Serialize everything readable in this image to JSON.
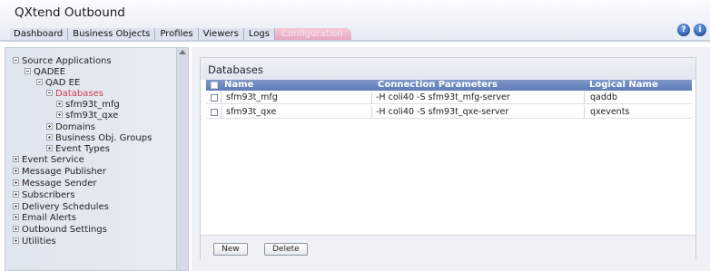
{
  "app": {
    "title": "QXtend Outbound"
  },
  "tabs": [
    {
      "label": "Dashboard"
    },
    {
      "label": "Business Objects"
    },
    {
      "label": "Profiles"
    },
    {
      "label": "Viewers"
    },
    {
      "label": "Logs"
    },
    {
      "label": "Configuration",
      "active": true
    }
  ],
  "header_icons": {
    "help": "?",
    "info": "i"
  },
  "tree": [
    {
      "label": "Source Applications",
      "expanded": true
    },
    {
      "label": "QADEE",
      "expanded": true
    },
    {
      "label": "QAD EE",
      "expanded": true
    },
    {
      "label": "Databases",
      "expanded": true,
      "selected": true
    },
    {
      "label": "sfm93t_mfg",
      "expanded": false
    },
    {
      "label": "sfm93t_qxe",
      "expanded": false
    },
    {
      "label": "Domains",
      "expanded": false
    },
    {
      "label": "Business Obj. Groups",
      "expanded": false
    },
    {
      "label": "Event Types",
      "expanded": false
    },
    {
      "label": "Event Service",
      "expanded": false
    },
    {
      "label": "Message Publisher",
      "expanded": false
    },
    {
      "label": "Message Sender",
      "expanded": false
    },
    {
      "label": "Subscribers",
      "expanded": false
    },
    {
      "label": "Delivery Schedules",
      "expanded": false
    },
    {
      "label": "Email Alerts",
      "expanded": false
    },
    {
      "label": "Outbound Settings",
      "expanded": false
    },
    {
      "label": "Utilities",
      "expanded": false
    }
  ],
  "databases": {
    "title": "Databases",
    "columns": {
      "name": "Name",
      "params": "Connection Parameters",
      "logical": "Logical Name"
    },
    "rows": [
      {
        "name": "sfm93t_mfg",
        "params": "-H coli40 -S sfm93t_mfg-server",
        "logical": "qaddb"
      },
      {
        "name": "sfm93t_qxe",
        "params": "-H coli40 -S sfm93t_qxe-server",
        "logical": "qxevents"
      }
    ],
    "buttons": {
      "new": "New",
      "delete": "Delete"
    }
  },
  "colors": {
    "selected_tree_item": "#d43a52",
    "table_header": "#6a86be",
    "active_tab": "#eab3c7"
  }
}
